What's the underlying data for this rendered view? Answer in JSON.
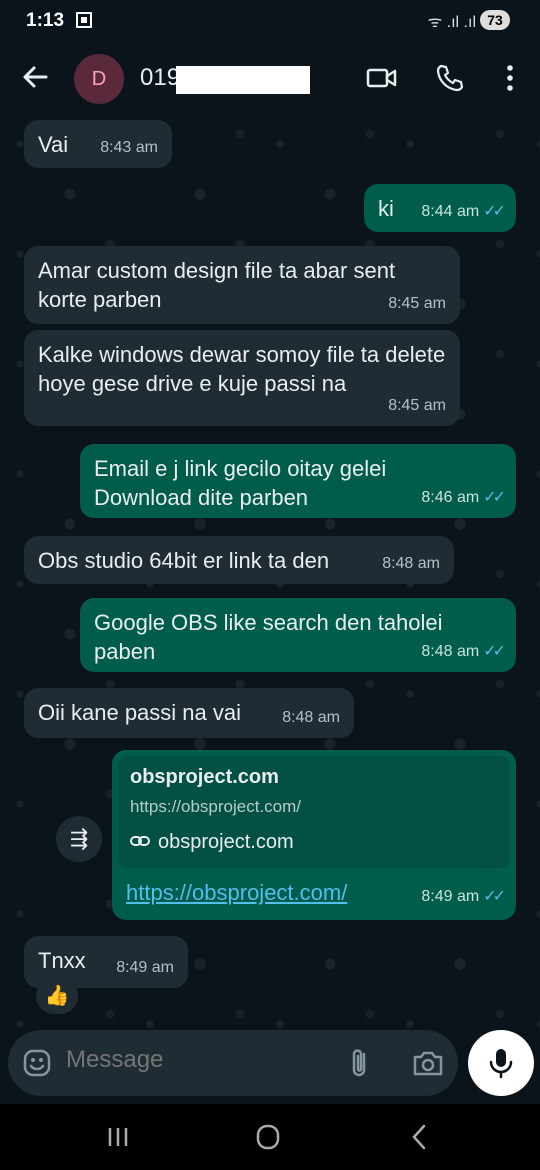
{
  "status": {
    "time": "1:13",
    "signal": "ᯤ .ıl .ıl",
    "battery": "73"
  },
  "header": {
    "avatar_letter": "D",
    "contact_name": "019"
  },
  "messages": [
    {
      "dir": "in",
      "text": "Vai",
      "time": "8:43 am"
    },
    {
      "dir": "out",
      "text": "ki",
      "time": "8:44 am"
    },
    {
      "dir": "in",
      "text": "Amar custom design file ta abar sent korte parben",
      "time": "8:45 am"
    },
    {
      "dir": "in",
      "text": "Kalke windows dewar somoy file ta delete hoye gese drive e kuje passi na",
      "time": "8:45 am"
    },
    {
      "dir": "out",
      "text": "Email e j link gecilo oitay gelei Download dite parben",
      "time": "8:46 am"
    },
    {
      "dir": "in",
      "text": "Obs studio 64bit er link ta den",
      "time": "8:48 am"
    },
    {
      "dir": "out",
      "text": "Google OBS like search den taholei paben",
      "time": "8:48 am"
    },
    {
      "dir": "in",
      "text": "Oii kane passi na vai",
      "time": "8:48 am"
    },
    {
      "dir": "in",
      "text": "Tnxx",
      "time": "8:49 am"
    }
  ],
  "link_message": {
    "domain": "obsproject.com",
    "url": "https://obsproject.com/",
    "site": "obsproject.com",
    "link_text": "https://obsproject.com/",
    "time": "8:49 am"
  },
  "reaction": "👍",
  "composer": {
    "placeholder": "Message"
  },
  "colors": {
    "incoming": "#202c33",
    "outgoing": "#005c4b",
    "read_ticks": "#53bdeb",
    "background": "#0b141a"
  }
}
